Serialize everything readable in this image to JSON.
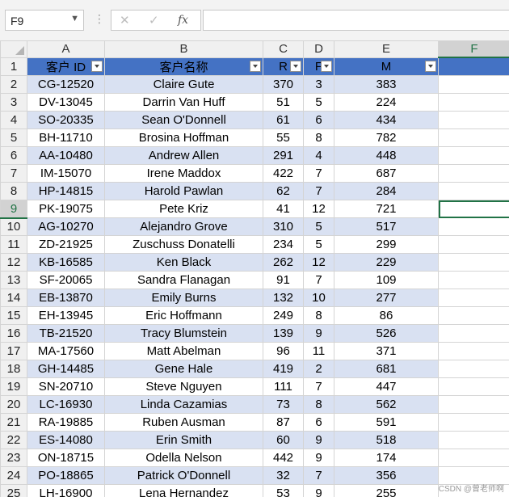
{
  "formula_bar": {
    "name_box": "F9",
    "cancel_glyph": "✕",
    "enter_glyph": "✓",
    "fx_glyph": "fx",
    "formula": ""
  },
  "grid": {
    "columns": [
      "A",
      "B",
      "C",
      "D",
      "E",
      "F"
    ],
    "headers": [
      "客户 ID",
      "客户名称",
      "R",
      "F",
      "M"
    ],
    "selected_cell": "F9",
    "rows": [
      [
        "CG-12520",
        "Claire Gute",
        "370",
        "3",
        "383"
      ],
      [
        "DV-13045",
        "Darrin Van Huff",
        "51",
        "5",
        "224"
      ],
      [
        "SO-20335",
        "Sean O'Donnell",
        "61",
        "6",
        "434"
      ],
      [
        "BH-11710",
        "Brosina Hoffman",
        "55",
        "8",
        "782"
      ],
      [
        "AA-10480",
        "Andrew Allen",
        "291",
        "4",
        "448"
      ],
      [
        "IM-15070",
        "Irene Maddox",
        "422",
        "7",
        "687"
      ],
      [
        "HP-14815",
        "Harold Pawlan",
        "62",
        "7",
        "284"
      ],
      [
        "PK-19075",
        "Pete Kriz",
        "41",
        "12",
        "721"
      ],
      [
        "AG-10270",
        "Alejandro Grove",
        "310",
        "5",
        "517"
      ],
      [
        "ZD-21925",
        "Zuschuss Donatelli",
        "234",
        "5",
        "299"
      ],
      [
        "KB-16585",
        "Ken Black",
        "262",
        "12",
        "229"
      ],
      [
        "SF-20065",
        "Sandra Flanagan",
        "91",
        "7",
        "109"
      ],
      [
        "EB-13870",
        "Emily Burns",
        "132",
        "10",
        "277"
      ],
      [
        "EH-13945",
        "Eric Hoffmann",
        "249",
        "8",
        "86"
      ],
      [
        "TB-21520",
        "Tracy Blumstein",
        "139",
        "9",
        "526"
      ],
      [
        "MA-17560",
        "Matt Abelman",
        "96",
        "11",
        "371"
      ],
      [
        "GH-14485",
        "Gene Hale",
        "419",
        "2",
        "681"
      ],
      [
        "SN-20710",
        "Steve Nguyen",
        "111",
        "7",
        "447"
      ],
      [
        "LC-16930",
        "Linda Cazamias",
        "73",
        "8",
        "562"
      ],
      [
        "RA-19885",
        "Ruben Ausman",
        "87",
        "6",
        "591"
      ],
      [
        "ES-14080",
        "Erin Smith",
        "60",
        "9",
        "518"
      ],
      [
        "ON-18715",
        "Odella Nelson",
        "442",
        "9",
        "174"
      ],
      [
        "PO-18865",
        "Patrick O'Donnell",
        "32",
        "7",
        "356"
      ],
      [
        "LH-16900",
        "Lena Hernandez",
        "53",
        "9",
        "255"
      ]
    ]
  },
  "watermark": "CSDN @曾老师啊",
  "colors": {
    "header_fill": "#4472c4",
    "band_fill": "#d9e1f2",
    "selection": "#217346"
  }
}
